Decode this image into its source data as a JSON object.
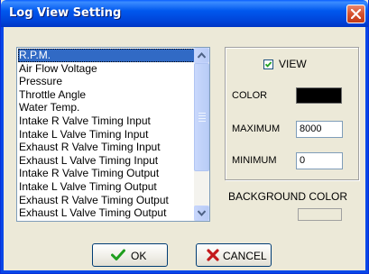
{
  "window": {
    "title": "Log View Setting"
  },
  "list": {
    "selected_index": 0,
    "items": [
      "R.P.M.",
      "Air Flow Voltage",
      "Pressure",
      "Throttle Angle",
      "Water Temp.",
      "Intake R Valve Timing Input",
      "Intake L Valve Timing Input",
      "Exhaust R Valve Timing Input",
      "Exhaust L Valve Timing Input",
      "Intake R Valve Timing Output",
      "Intake L Valve Timing Output",
      "Exhaust R Valve Timing Output",
      "Exhaust L Valve Timing Output"
    ]
  },
  "settings": {
    "view_label": "VIEW",
    "view_checked": true,
    "color_label": "COLOR",
    "color_value": "#000000",
    "maximum_label": "MAXIMUM",
    "maximum_value": "8000",
    "minimum_label": "MINIMUM",
    "minimum_value": "0",
    "background_label": "BACKGROUND COLOR",
    "background_value": "#ECE9D8"
  },
  "buttons": {
    "ok": "OK",
    "cancel": "CANCEL"
  },
  "icons": {
    "close": "close-icon",
    "ok": "checkmark-icon",
    "cancel": "x-icon",
    "scroll_up": "arrow-up-icon",
    "scroll_down": "arrow-down-icon"
  },
  "colors": {
    "title_bar": "#0058EE",
    "selection": "#316AC5",
    "dialog_bg": "#ECE9D8"
  }
}
